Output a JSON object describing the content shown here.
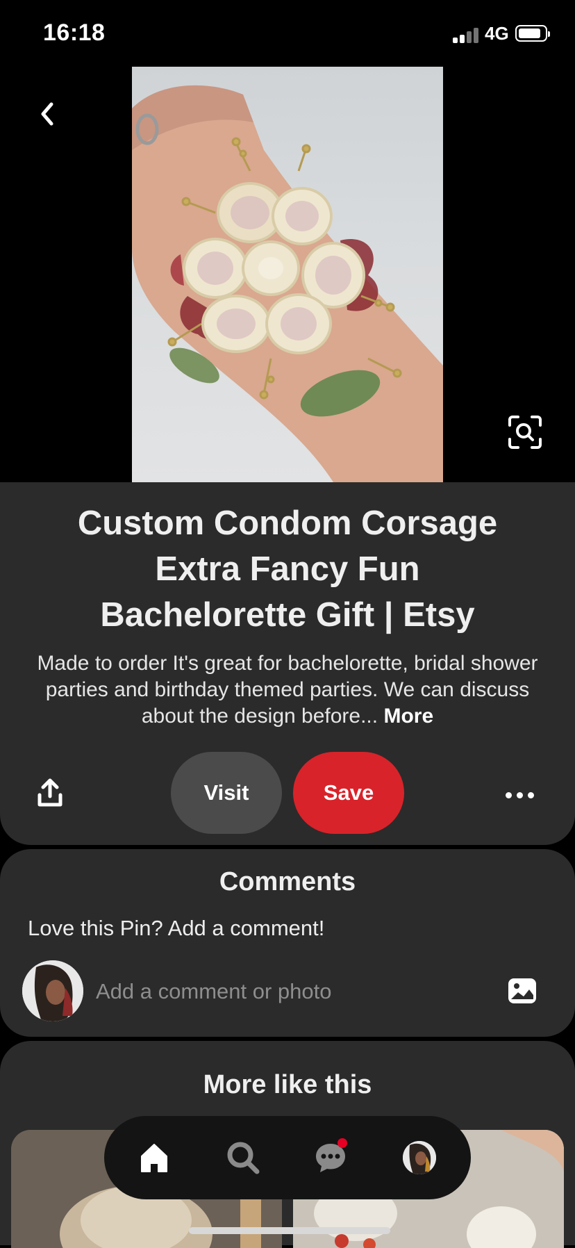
{
  "status_bar": {
    "time": "16:18",
    "network": "4G"
  },
  "pin": {
    "title_lines": [
      "Custom Condom Corsage",
      "Extra Fancy  Fun",
      "Bachelorette Gift  | Etsy"
    ],
    "description": "Made to order It's great for bachelorette, bridal shower parties and birthday themed parties. We can discuss about the design before...",
    "more_label": "More"
  },
  "actions": {
    "visit_label": "Visit",
    "save_label": "Save"
  },
  "comments": {
    "title": "Comments",
    "prompt": "Love this Pin? Add a comment!",
    "input_placeholder": "Add a comment or photo"
  },
  "more_like_this": {
    "title": "More like this"
  },
  "icons": {
    "back": "chevron-left-icon",
    "visual_search": "lens-search-icon",
    "share": "share-icon",
    "more": "ellipsis-icon",
    "photo": "photo-icon",
    "home": "home-icon",
    "search": "search-icon",
    "messages": "chat-icon",
    "profile": "avatar"
  },
  "colors": {
    "save": "#d8232a",
    "visit": "#4b4b4b",
    "card": "#2b2b2b",
    "notification": "#e60023"
  }
}
